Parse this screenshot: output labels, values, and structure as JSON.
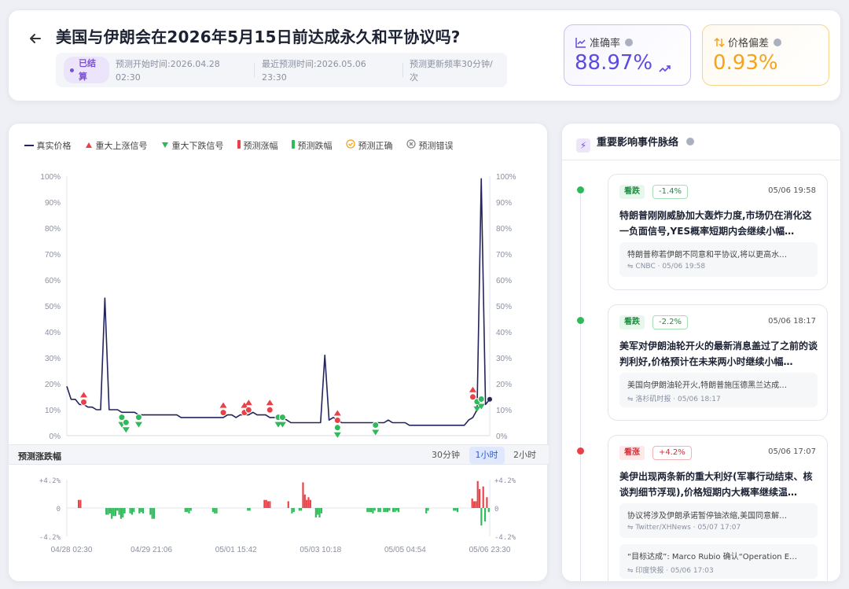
{
  "header": {
    "title": "美国与伊朗会在2026年5月15日前达成永久和平协议吗?",
    "status_line1": "已结",
    "status_line2": "算",
    "start_label": "预测开始时间:2026.04.28",
    "start_time": "02:30",
    "latest_label": "最近预测时间:2026.05.06",
    "latest_time": "23:30",
    "freq_label": "预测更新频率30分钟/",
    "freq_unit": "次"
  },
  "kpis": {
    "accuracy_label": "准确率",
    "accuracy_value": "88.97%",
    "deviation_label": "价格偏差",
    "deviation_value": "0.93%",
    "colors": {
      "accuracy": "#5b4be0",
      "deviation": "#f5a31a"
    }
  },
  "legend": {
    "real_price": "真实价格",
    "major_up": "重大上涨信号",
    "major_down": "重大下跌信号",
    "pred_up": "预测涨幅",
    "pred_down": "预测跌幅",
    "pred_correct": "预测正确",
    "pred_wrong": "预测错误"
  },
  "sub_panel": {
    "title": "预测涨跌幅",
    "tabs": [
      "30分钟",
      "1小时",
      "2小时"
    ],
    "active_tab": "1小时"
  },
  "chart_data": [
    {
      "type": "line",
      "ylim": [
        0,
        100
      ],
      "y_ticks": [
        "100%",
        "90%",
        "80%",
        "70%",
        "60%",
        "50%",
        "40%",
        "30%",
        "20%",
        "10%",
        "0%"
      ],
      "series": [
        {
          "name": "真实价格",
          "color": "#23235e",
          "x": [
            0,
            1,
            2,
            3,
            4,
            5,
            6,
            7,
            8,
            9,
            10,
            11,
            12,
            13,
            14,
            15,
            16,
            17,
            18,
            19,
            20,
            21,
            22,
            23,
            24,
            25,
            26,
            27,
            28,
            29,
            30,
            31,
            32,
            33,
            34,
            35,
            36,
            37,
            38,
            39,
            40,
            41,
            42,
            43,
            44,
            45,
            46,
            47,
            48,
            49,
            50,
            51,
            52,
            53,
            54,
            55,
            56,
            57,
            58,
            59,
            60,
            61,
            62,
            63,
            64,
            65,
            66,
            67,
            68,
            69,
            70,
            71,
            72,
            73,
            74,
            75,
            76,
            77,
            78,
            79,
            80,
            81,
            82,
            83,
            84,
            85,
            86,
            87,
            88,
            89,
            90,
            91,
            92,
            93,
            94,
            95,
            96,
            97,
            98,
            99,
            100
          ],
          "y": [
            19,
            14,
            14,
            12,
            12,
            11,
            11,
            10,
            10,
            53,
            10,
            10,
            10,
            9,
            9,
            9,
            9,
            8,
            8,
            8,
            8,
            8,
            8,
            8,
            8,
            8,
            8,
            7,
            7,
            7,
            7,
            7,
            7,
            7,
            7,
            7,
            7,
            7,
            8,
            8,
            7,
            8,
            8,
            8,
            9,
            8,
            8,
            8,
            7,
            7,
            7,
            7,
            6,
            5,
            5,
            5,
            5,
            5,
            5,
            5,
            5,
            31,
            6,
            7,
            6,
            5,
            5,
            5,
            5,
            5,
            5,
            5,
            5,
            5,
            5,
            5,
            6,
            5,
            5,
            5,
            5,
            4,
            4,
            4,
            4,
            4,
            4,
            4,
            4,
            4,
            4,
            4,
            4,
            4,
            4,
            6,
            7,
            10,
            99,
            12,
            14
          ]
        }
      ],
      "signals": [
        {
          "x": 4,
          "y": 12,
          "type": "up",
          "correct": false
        },
        {
          "x": 13,
          "y": 8,
          "type": "down",
          "correct": true
        },
        {
          "x": 14,
          "y": 6,
          "type": "down",
          "correct": true
        },
        {
          "x": 17,
          "y": 8,
          "type": "down",
          "correct": true
        },
        {
          "x": 37,
          "y": 8,
          "type": "up",
          "correct": false
        },
        {
          "x": 42,
          "y": 8,
          "type": "up",
          "correct": false
        },
        {
          "x": 43,
          "y": 9,
          "type": "up",
          "correct": false
        },
        {
          "x": 48,
          "y": 9,
          "type": "up",
          "correct": false
        },
        {
          "x": 50,
          "y": 8,
          "type": "down",
          "correct": true
        },
        {
          "x": 51,
          "y": 8,
          "type": "down",
          "correct": true
        },
        {
          "x": 64,
          "y": 5,
          "type": "up",
          "correct": false
        },
        {
          "x": 64,
          "y": 4,
          "type": "down",
          "correct": true
        },
        {
          "x": 73,
          "y": 5,
          "type": "down",
          "correct": true
        },
        {
          "x": 96,
          "y": 14,
          "type": "up",
          "correct": false
        },
        {
          "x": 97,
          "y": 14,
          "type": "down",
          "correct": true
        },
        {
          "x": 98,
          "y": 15,
          "type": "down",
          "correct": true
        }
      ]
    },
    {
      "type": "bar",
      "title": "预测涨跌幅",
      "ylim": [
        -4.2,
        4.2
      ],
      "y_ticks": [
        "+4.2%",
        "0",
        "-4.2%"
      ],
      "x_ticks": [
        "04/28 02:30",
        "04/29 21:06",
        "05/01 15:42",
        "05/03 10:18",
        "05/05 04:54",
        "05/06 23:30"
      ],
      "values": [
        0,
        0,
        0,
        0,
        0,
        0,
        1.2,
        1.2,
        0,
        0,
        0,
        0,
        0,
        0,
        0,
        0,
        0,
        0,
        0,
        0,
        0,
        -1,
        -1,
        -0.8,
        -1.6,
        -1.2,
        -1.2,
        -0.4,
        -1,
        -1.6,
        -1.4,
        -0.8,
        0,
        0,
        -0.8,
        -1,
        -0.6,
        0,
        0,
        -0.8,
        -0.6,
        -0.8,
        0,
        0,
        0,
        -1,
        -1.6,
        -1.6,
        0,
        0,
        0,
        0,
        0,
        0,
        0,
        0,
        0,
        0,
        0,
        0,
        0,
        0,
        0,
        0,
        -0.6,
        -0.6,
        -0.8,
        -0.4,
        0,
        0,
        0,
        0,
        0,
        0,
        0,
        0,
        0,
        0,
        0,
        -0.6,
        -0.8,
        -0.8,
        0,
        0,
        0,
        0,
        0,
        0,
        0,
        0,
        0,
        0,
        0,
        0,
        0,
        0,
        0,
        0,
        -0.4,
        -0.4,
        0,
        0,
        0,
        0,
        0,
        0,
        0,
        1.2,
        1.2,
        1,
        1,
        0,
        0,
        0,
        0,
        0,
        0,
        0,
        0,
        0,
        1,
        0,
        -0.8,
        -0.6,
        0,
        0,
        -0.4,
        -0.4,
        3.8,
        2,
        1.2,
        1.6,
        1.2,
        0,
        0,
        -1.4,
        -1,
        -1.4,
        -0.8,
        0,
        0,
        0,
        0,
        0,
        0,
        0,
        0,
        0,
        0,
        0,
        0,
        0,
        0,
        0,
        0,
        0,
        0,
        0,
        0,
        0,
        0,
        0,
        0,
        -0.6,
        -0.6,
        -0.6,
        -0.8,
        -0.4,
        0,
        -0.6,
        -0.6,
        0,
        -0.6,
        -0.6,
        -0.6,
        -0.4,
        0,
        -0.6,
        -0.6,
        -0.4,
        -0.6,
        0,
        0,
        0,
        0,
        0,
        0,
        0,
        0,
        0,
        0,
        0,
        0,
        0,
        0,
        -0.8,
        -0.4,
        0,
        0,
        0,
        0,
        0,
        0,
        0,
        0,
        0,
        0,
        0,
        0,
        0,
        -0.4,
        -0.4,
        -0.6,
        0,
        0,
        0,
        0,
        0,
        0,
        0,
        1.4,
        1,
        1,
        4,
        2.8,
        -2.6,
        3.2,
        -2,
        1.6,
        -0.6
      ]
    }
  ],
  "events": {
    "title": "重要影响事件脉络",
    "items": [
      {
        "tag": "看跌",
        "tag_type": "down",
        "change": "-1.4%",
        "time": "05/06 19:58",
        "title": "特朗普刚刚威胁加大轰炸力度,市场仍在消化这一负面信号,YES概率短期内会继续小幅…",
        "sources": [
          {
            "text": "特朗普称若伊朗不同意和平协议,将以更高水…",
            "meta_src": "CNBC",
            "meta_time": "05/06 19:58"
          }
        ]
      },
      {
        "tag": "看跌",
        "tag_type": "down",
        "change": "-2.2%",
        "time": "05/06 18:17",
        "title": "美军对伊朗油轮开火的最新消息盖过了之前的谈判利好,价格预计在未来两小时继续小幅…",
        "sources": [
          {
            "text": "美国向伊朗油轮开火,特朗普施压德黑兰达成…",
            "meta_src": "洛杉矶时报",
            "meta_time": "05/06 18:17"
          }
        ]
      },
      {
        "tag": "看涨",
        "tag_type": "up",
        "change": "+4.2%",
        "time": "05/06 17:07",
        "title": "美伊出现两条新的重大利好(军事行动结束、核谈判细节浮现),价格短期内大概率继续温…",
        "sources": [
          {
            "text": "协议将涉及伊朗承诺暂停铀浓缩,美国同意解…",
            "meta_src": "Twitter/XHNews",
            "meta_time": "05/07 17:07"
          },
          {
            "text": "“目标达成”: Marco Rubio 确认“Operation E…",
            "meta_src": "印度快报",
            "meta_time": "05/06 17:03"
          }
        ]
      }
    ]
  }
}
